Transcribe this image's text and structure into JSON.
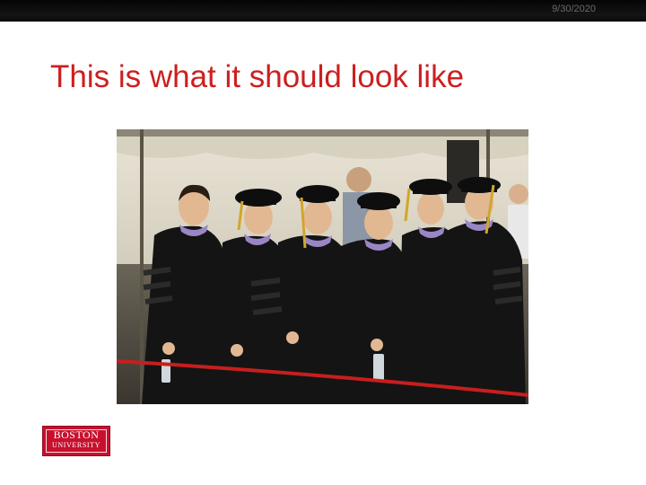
{
  "header": {
    "date": "9/30/2020"
  },
  "slide": {
    "title": "This is what it should look like"
  },
  "photo": {
    "description_icon": "graduation-photo"
  },
  "logo": {
    "line1": "BOSTON",
    "line2": "UNIVERSITY"
  },
  "colors": {
    "title_red": "#cc1f1f",
    "logo_red": "#c8102e",
    "top_bar": "#0b0b0b"
  }
}
